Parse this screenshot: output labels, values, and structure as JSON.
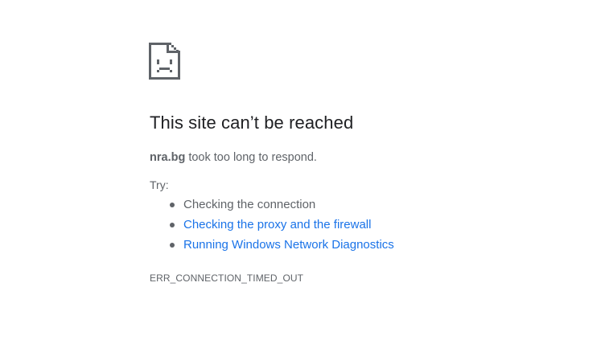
{
  "icon": "sad-page-icon",
  "heading": "This site can’t be reached",
  "summary": {
    "host": "nra.bg",
    "message": " took too long to respond."
  },
  "try_label": "Try:",
  "suggestions": [
    {
      "label": "Checking the connection",
      "is_link": false
    },
    {
      "label": "Checking the proxy and the firewall",
      "is_link": true
    },
    {
      "label": "Running Windows Network Diagnostics",
      "is_link": true
    }
  ],
  "error_code": "ERR_CONNECTION_TIMED_OUT",
  "colors": {
    "heading": "#202124",
    "body_text": "#5f6368",
    "link": "#1a73e8"
  }
}
